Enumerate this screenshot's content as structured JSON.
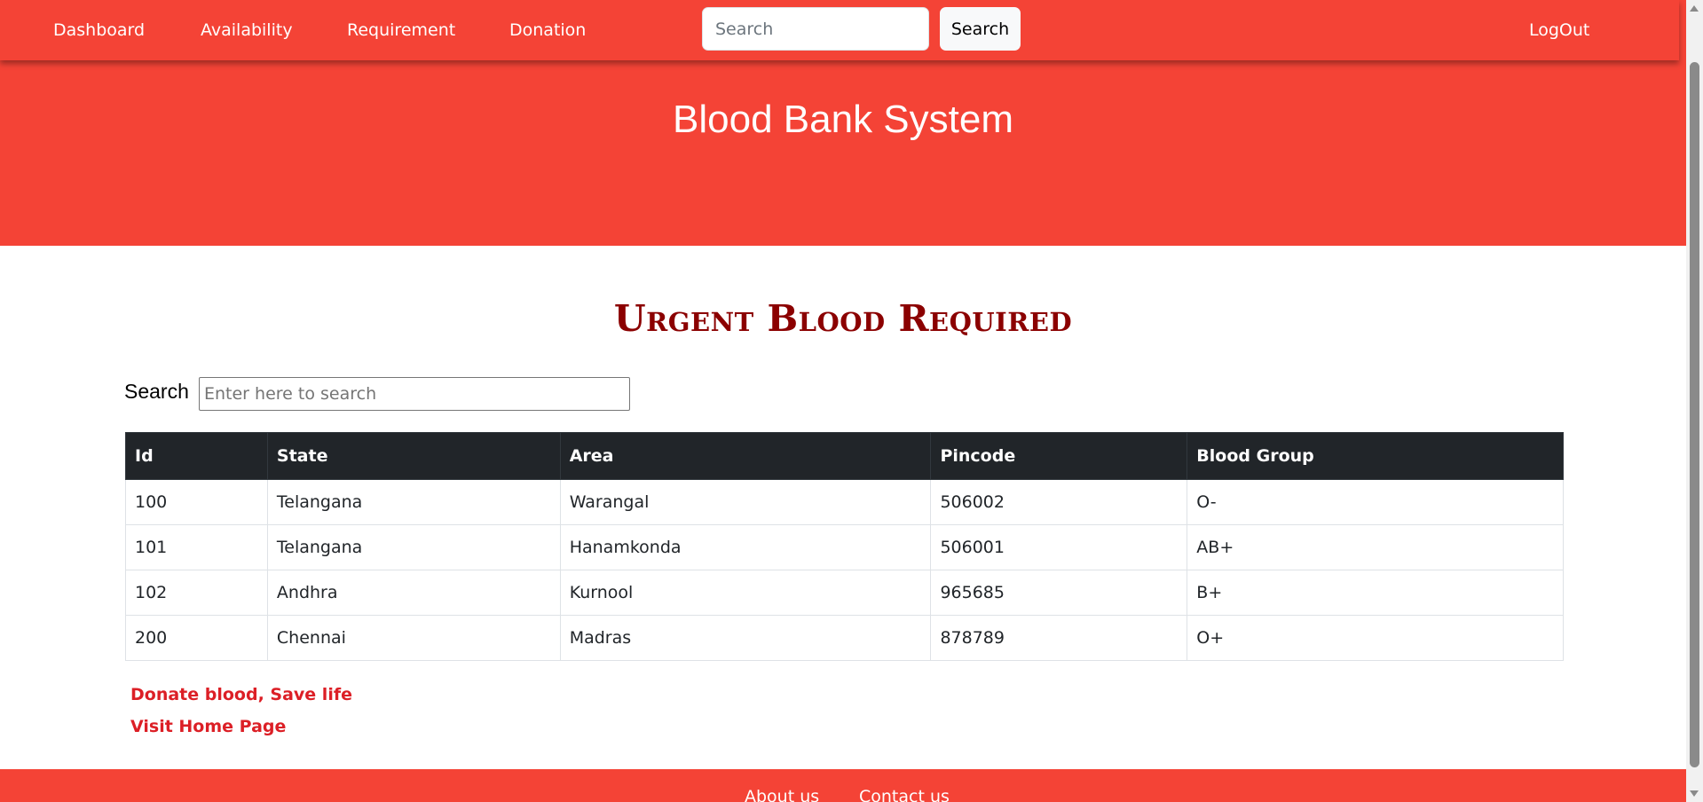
{
  "nav": {
    "items": [
      {
        "label": "Dashboard"
      },
      {
        "label": "Availability"
      },
      {
        "label": "Requirement"
      },
      {
        "label": "Donation"
      }
    ],
    "search_placeholder": "Search",
    "search_button": "Search",
    "logout": "LogOut"
  },
  "hero": {
    "title": "Blood Bank System"
  },
  "main": {
    "heading": "Urgent Blood Required",
    "search_label": "Search",
    "search_placeholder": "Enter here to search",
    "table": {
      "columns": [
        "Id",
        "State",
        "Area",
        "Pincode",
        "Blood Group"
      ],
      "rows": [
        [
          "100",
          "Telangana",
          "Warangal",
          "506002",
          "O-"
        ],
        [
          "101",
          "Telangana",
          "Hanamkonda",
          "506001",
          "AB+"
        ],
        [
          "102",
          "Andhra",
          "Kurnool",
          "965685",
          "B+"
        ],
        [
          "200",
          "Chennai",
          "Madras",
          "878789",
          "O+"
        ]
      ]
    },
    "links": {
      "donate": "Donate blood, Save life",
      "home": "Visit Home Page"
    }
  },
  "footer": {
    "about": "About us",
    "contact": "Contact us"
  },
  "colors": {
    "brand": "#f44336",
    "heading": "#8b0000",
    "link": "#dc1f26",
    "table_header": "#212529"
  }
}
